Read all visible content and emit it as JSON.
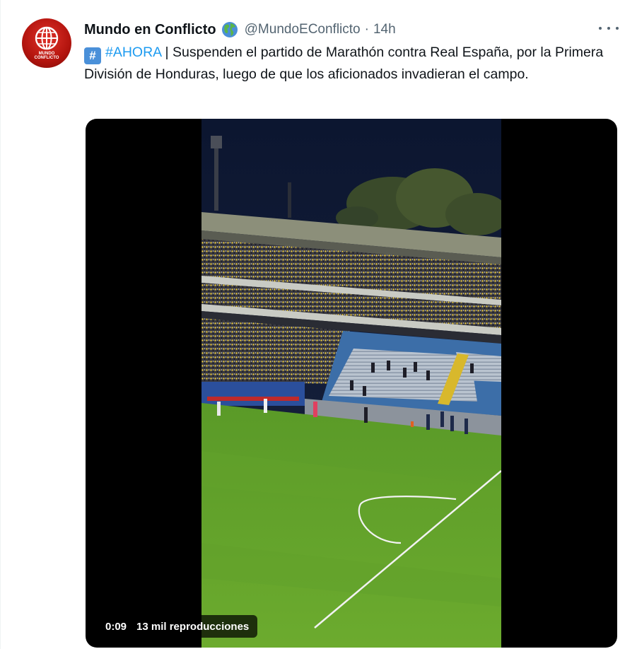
{
  "tweet": {
    "display_name": "Mundo en Conflicto",
    "verified_emoji": "earth-globe-americas-icon",
    "handle": "@MundoEConflicto",
    "separator": "·",
    "time": "14h",
    "avatar_text_line1": "MUNDO",
    "avatar_text_line2": "CONFLICTO",
    "text": {
      "emoji": "#",
      "hashtag": "#AHORA",
      "body": " | Suspenden el partido de Marathón contra Real España, por la Primera División de Honduras, luego de que los aficionados invadieran el campo."
    },
    "more_icon": "ellipsis-icon"
  },
  "video": {
    "elapsed": "0:09",
    "views": "13 mil reproducciones"
  },
  "colors": {
    "text_primary": "#0f1419",
    "text_secondary": "#536471",
    "link": "#1d9bf0",
    "avatar_red": "#c41e16",
    "pitch_green": "#5e9c2a"
  }
}
